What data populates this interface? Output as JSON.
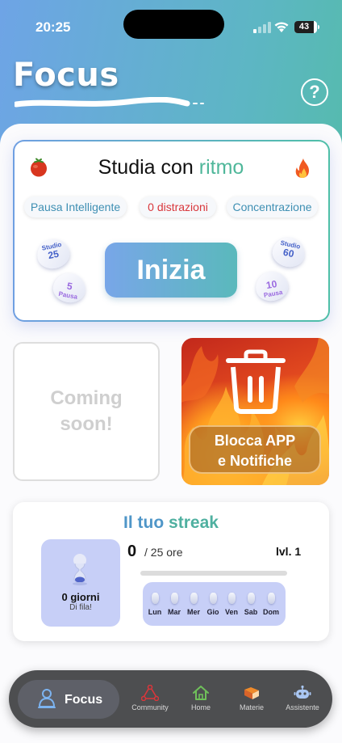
{
  "status_bar": {
    "time": "20:25",
    "battery": "43"
  },
  "header": {
    "title": "Focus",
    "help_label": "?"
  },
  "focus_card": {
    "title_prefix": "Studia con ",
    "title_accent": "ritmo",
    "chips": [
      "Pausa Intelligente",
      "0 distrazioni",
      "Concentrazione"
    ],
    "start_label": "Inizia",
    "preset_left": {
      "study_label": "Studio",
      "study_value": "25",
      "break_value": "5",
      "break_label": "Pausa"
    },
    "preset_right": {
      "study_label": "Studio",
      "study_value": "60",
      "break_value": "10",
      "break_label": "Pausa"
    }
  },
  "coming_soon": {
    "line1": "Coming",
    "line2": "soon!"
  },
  "block_card": {
    "line1": "Blocca APP",
    "line2": "e Notifiche"
  },
  "streak": {
    "title_a": "Il tuo ",
    "title_b": "streak",
    "days_count": "0 giorni",
    "days_sub": "Di fila!",
    "hours_value": "0",
    "hours_of": "/ 25 ore",
    "level": "lvl. 1",
    "progress": 0,
    "week_days": [
      "Lun",
      "Mar",
      "Mer",
      "Gio",
      "Ven",
      "Sab",
      "Dom"
    ]
  },
  "tabbar": {
    "active": "Focus",
    "tabs": [
      {
        "label": "Community",
        "icon": "community-icon"
      },
      {
        "label": "Home",
        "icon": "home-icon"
      },
      {
        "label": "Materie",
        "icon": "book-icon"
      },
      {
        "label": "Assistente",
        "icon": "robot-icon"
      }
    ]
  },
  "colors": {
    "accent_teal": "#4fb79a",
    "accent_blue": "#4f96c8",
    "distraction_red": "#d9363b"
  }
}
